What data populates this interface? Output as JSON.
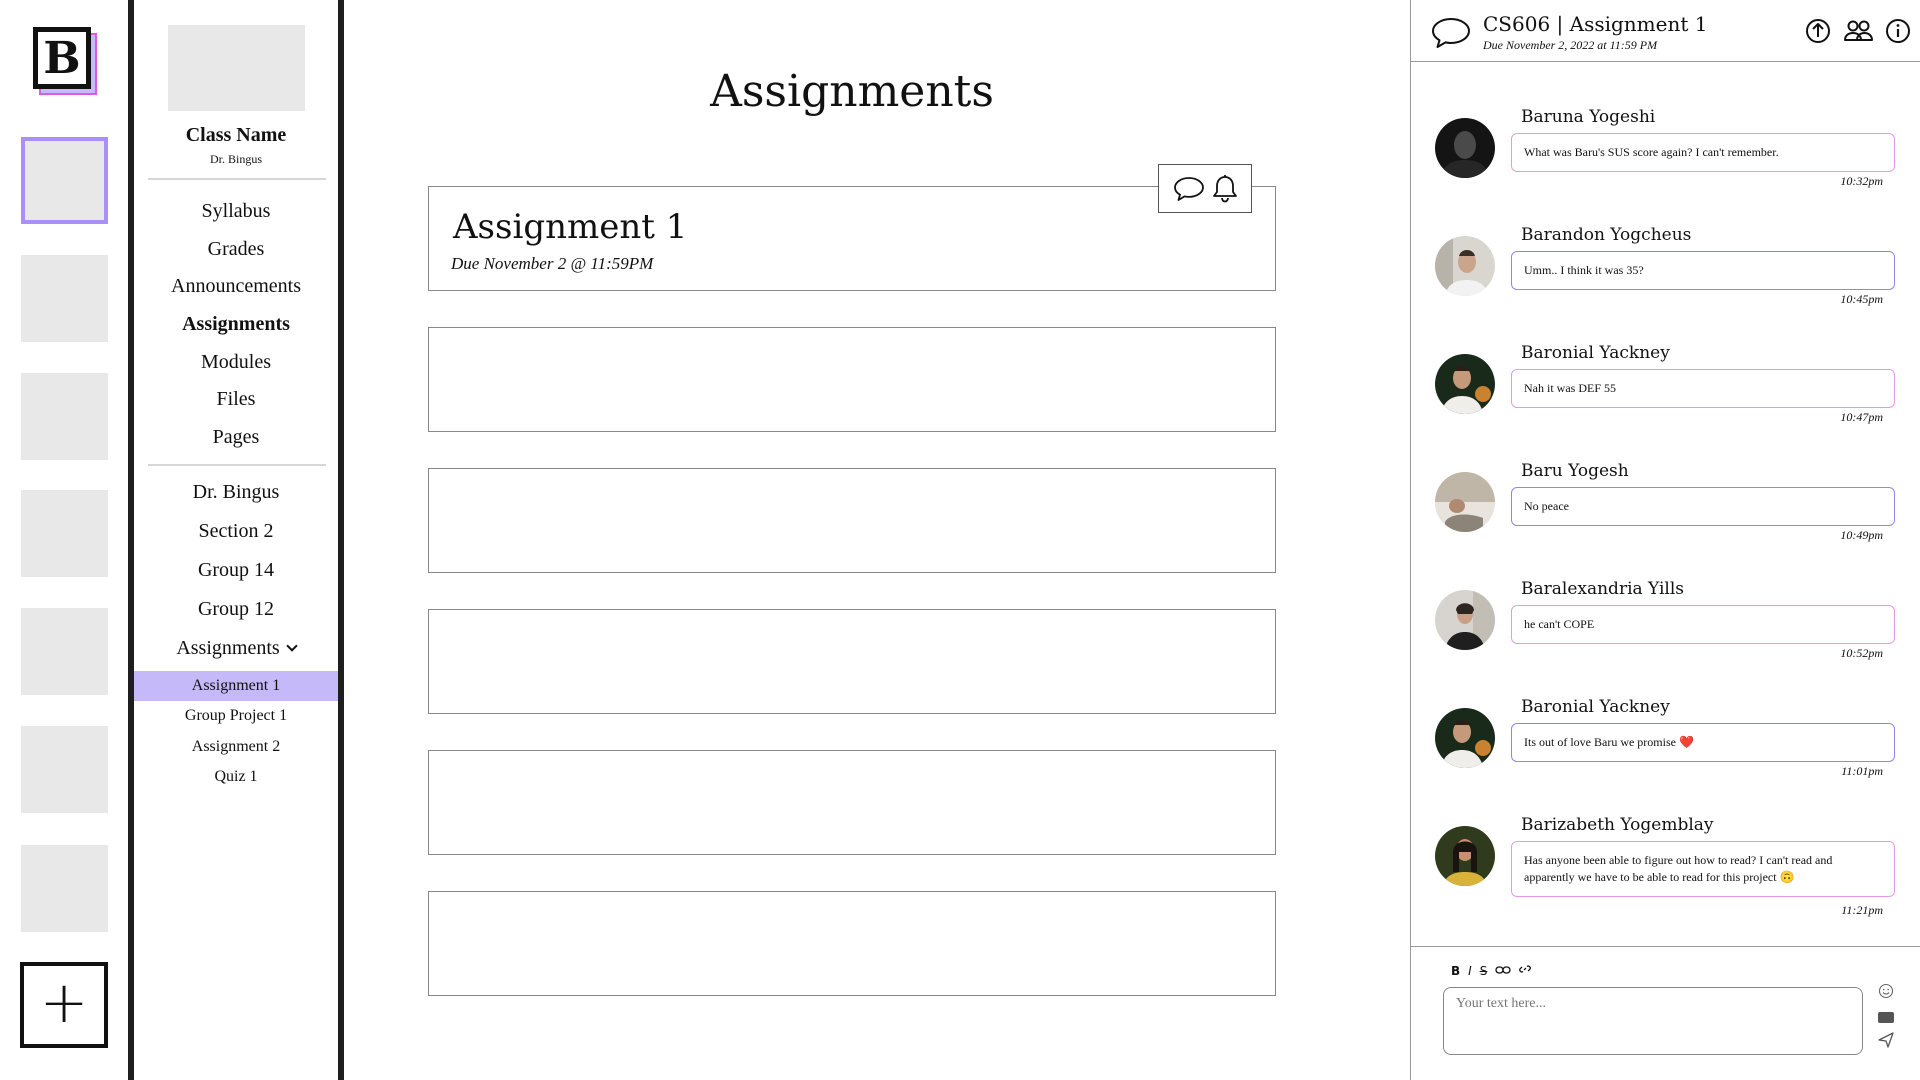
{
  "rail": {
    "logo_letter": "B",
    "add_label": "+"
  },
  "sidebar": {
    "class_name": "Class Name",
    "professor": "Dr. Bingus",
    "nav": [
      "Syllabus",
      "Grades",
      "Announcements",
      "Assignments",
      "Modules",
      "Files",
      "Pages"
    ],
    "active_nav": "Assignments",
    "groups": [
      "Dr. Bingus",
      "Section 2",
      "Group 14",
      "Group 12"
    ],
    "assignments_dropdown": "Assignments",
    "sub_items": [
      "Assignment 1",
      "Group Project 1",
      "Assignment 2",
      "Quiz 1"
    ],
    "active_sub": "Assignment 1"
  },
  "main": {
    "title": "Assignments",
    "assignment": {
      "title": "Assignment 1",
      "due": "Due November 2 @ 11:59PM"
    }
  },
  "chat": {
    "title": "CS606 | Assignment 1",
    "subtitle": "Due November 2, 2022 at 11:59 PM",
    "messages": [
      {
        "name": "Baruna Yogeshi",
        "text": "What was Baru's SUS score again? I can't remember.",
        "time": "10:32pm"
      },
      {
        "name": "Barandon Yogcheus",
        "text": "Umm.. I think it was 35?",
        "time": "10:45pm"
      },
      {
        "name": "Baronial Yackney",
        "text": "Nah it was DEF 55",
        "time": "10:47pm"
      },
      {
        "name": "Baru Yogesh",
        "text": "No peace",
        "time": "10:49pm"
      },
      {
        "name": "Baralexandria Yills",
        "text": "he can't COPE",
        "time": "10:52pm"
      },
      {
        "name": "Baronial Yackney",
        "text": "Its out of love Baru we promise ❤️",
        "time": "11:01pm"
      },
      {
        "name": "Barizabeth Yogemblay",
        "text": "Has anyone been able to figure out how to read? I can't read and apparently we have to be able to read for this project 🙃",
        "time": "11:21pm"
      }
    ],
    "input_placeholder": "Your text here...",
    "format_buttons": [
      "B",
      "I",
      "S"
    ]
  },
  "colors": {
    "accent_purple": "#c6b9f9",
    "tile_gray": "#e8e8e8",
    "bubble_pink": "#e39ae6",
    "bubble_purple": "#8e85f0",
    "divider": "#1e1e1e"
  }
}
